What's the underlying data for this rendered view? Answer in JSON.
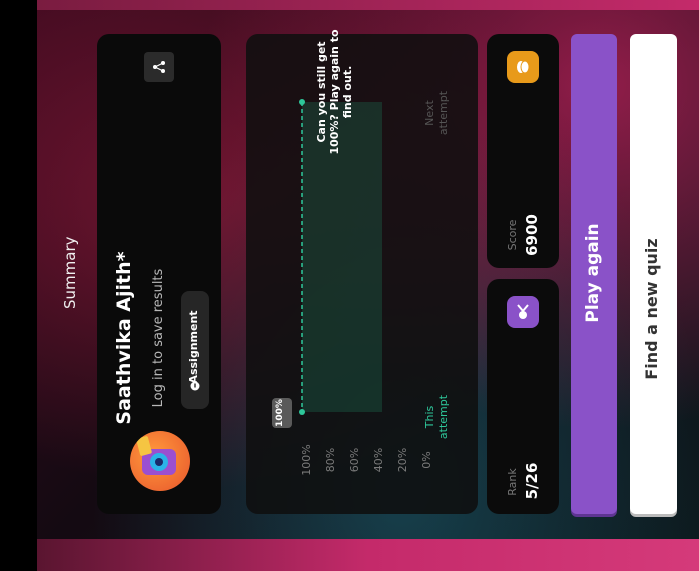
{
  "summary": {
    "title": "Summary"
  },
  "player": {
    "name": "Saathvika Ajith*",
    "login_prompt": "Log in to save results",
    "badge_label": "Assignment"
  },
  "chart_data": {
    "type": "bar",
    "categories": [
      "This attempt",
      "Next attempt"
    ],
    "values": [
      100,
      null
    ],
    "ylim": [
      0,
      100
    ],
    "y_ticks": [
      "100%",
      "80%",
      "60%",
      "40%",
      "20%",
      "0%"
    ],
    "data_labels": [
      "100%"
    ],
    "annotation": "Can you still get 100%? Play again to find out."
  },
  "stats": {
    "rank_label": "Rank",
    "rank_value": "5/26",
    "score_label": "Score",
    "score_value": "6900"
  },
  "actions": {
    "play_again": "Play again",
    "find_quiz": "Find a new quiz"
  },
  "colors": {
    "accent_purple": "#8a52c8",
    "accent_green": "#2ec79a",
    "score_badge": "#e89a1a",
    "rank_badge": "#8a52c8"
  }
}
